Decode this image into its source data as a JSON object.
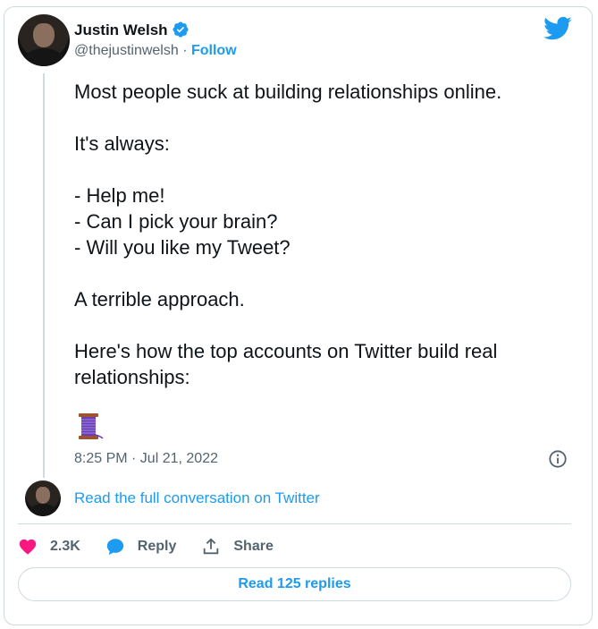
{
  "author": {
    "name": "Justin Welsh",
    "handle": "@thejustinwelsh",
    "separator": "·",
    "follow_label": "Follow"
  },
  "tweet": {
    "text": "Most people suck at building relationships online.\n\nIt's always:\n\n- Help me!\n- Can I pick your brain?\n- Will you like my Tweet?\n\nA terrible approach.\n\nHere's how the top accounts on Twitter build real relationships:",
    "timestamp": "8:25 PM · Jul 21, 2022"
  },
  "conversation_link": "Read the full conversation on Twitter",
  "actions": {
    "like_count": "2.3K",
    "reply_label": "Reply",
    "share_label": "Share"
  },
  "read_replies_label": "Read 125 replies",
  "colors": {
    "accent": "#1d9bf0",
    "like": "#f91880",
    "text": "#0f1419",
    "secondary": "#536471",
    "border": "#cfd9de"
  },
  "icons": [
    "verified-badge-icon",
    "twitter-bird-icon",
    "thread-spool-icon",
    "info-icon",
    "heart-icon",
    "reply-bubble-icon",
    "share-icon"
  ]
}
